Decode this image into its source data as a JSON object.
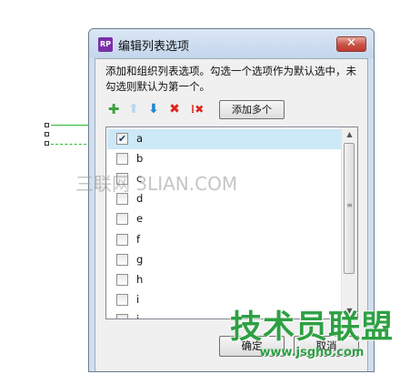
{
  "dialog": {
    "app_icon_text": "RP",
    "title": "编辑列表选项",
    "close_glyph": "✕",
    "description": "添加和组织列表选项。勾选一个选项作为默认选中，未勾选则默认为第一个。"
  },
  "toolbar": {
    "add_icon": "plus-icon",
    "add_glyph": "✚",
    "move_up_glyph": "⬆",
    "move_down_glyph": "⬇",
    "delete_glyph": "✖",
    "delete_all_glyph": "⁞✖",
    "add_multiple_label": "添加多个"
  },
  "options": [
    {
      "label": "a",
      "checked": true,
      "selected": true
    },
    {
      "label": "b",
      "checked": false,
      "selected": false
    },
    {
      "label": "c",
      "checked": false,
      "selected": false
    },
    {
      "label": "d",
      "checked": false,
      "selected": false
    },
    {
      "label": "e",
      "checked": false,
      "selected": false
    },
    {
      "label": "f",
      "checked": false,
      "selected": false
    },
    {
      "label": "g",
      "checked": false,
      "selected": false
    },
    {
      "label": "h",
      "checked": false,
      "selected": false
    },
    {
      "label": "i",
      "checked": false,
      "selected": false
    },
    {
      "label": "j",
      "checked": false,
      "selected": false
    }
  ],
  "scrollbar": {
    "up_glyph": "▲",
    "down_glyph": "▼",
    "grip_glyph": "≡"
  },
  "footer": {
    "ok_label": "确定",
    "cancel_label": "取消"
  },
  "watermarks": {
    "site_a": "三联网 3LIAN.COM",
    "site_b_name": "技术员联盟",
    "site_b_url": "www.jsgho.com"
  },
  "colors": {
    "accent_green": "#2ea043",
    "selection": "#cde8f7",
    "close_red": "#c85245"
  }
}
